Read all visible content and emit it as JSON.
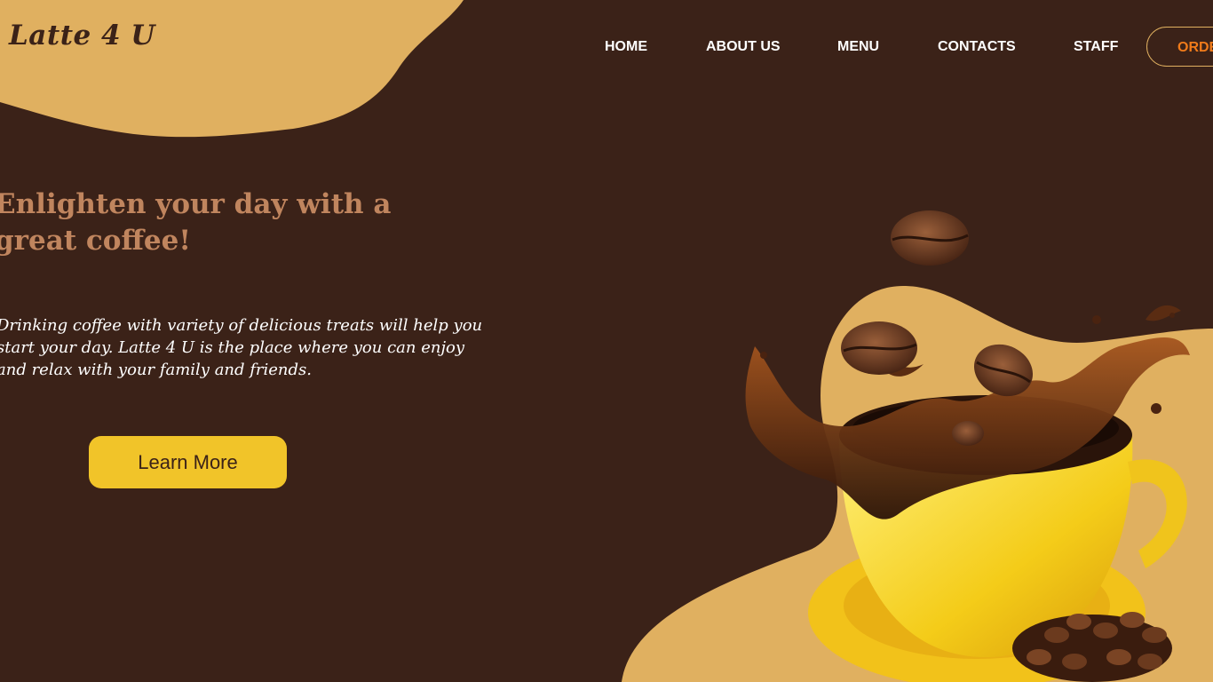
{
  "brand": {
    "logo_text": "Latte 4 U"
  },
  "nav": {
    "items": [
      {
        "label": "HOME"
      },
      {
        "label": "ABOUT US"
      },
      {
        "label": "MENU"
      },
      {
        "label": "CONTACTS"
      },
      {
        "label": "STAFF"
      }
    ],
    "order_label": "ORDER"
  },
  "hero": {
    "title": "Enlighten your day with a great coffee!",
    "text": "Drinking coffee with variety of delicious treats will help you start your day. Latte 4 U is the place where you can enjoy and relax with your family and friends.",
    "button_label": "Learn More"
  },
  "colors": {
    "background": "#3b2218",
    "accent_blob": "#e0b060",
    "title": "#c0855e",
    "button": "#f1c429",
    "order_text": "#f07b1a"
  }
}
